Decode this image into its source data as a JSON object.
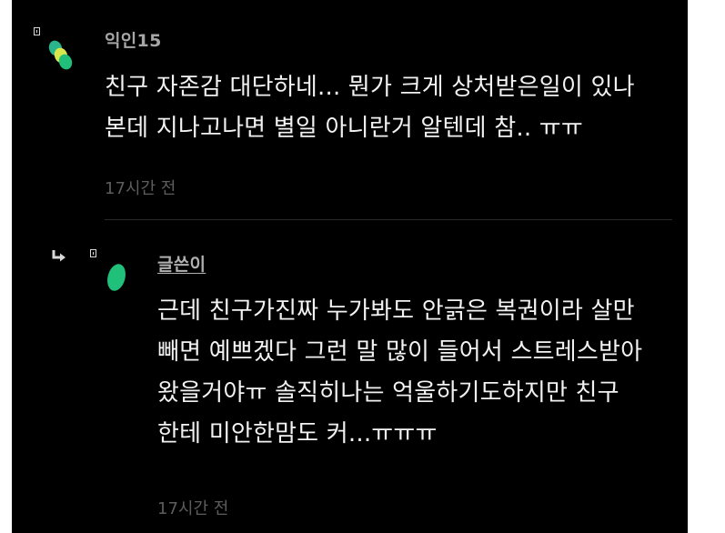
{
  "comments": [
    {
      "nickname": "익인15",
      "content": "친구 자존감 대단하네... 뭔가 크게 상처받은일이 있나\n본데 지나고나면 별일 아니란거 알텐데 참.. ㅠㅠ",
      "time": "17시간 전"
    }
  ],
  "replies": [
    {
      "nickname": "글쓴이",
      "content": "근데 친구가진짜 누가봐도 안긁은 복권이라 살만\n빼면 예쁘겠다 그런 말 많이 들어서 스트레스받아\n왔을거야ㅠ 솔직히나는 억울하기도하지만 친구\n한테 미안한맘도 커...ㅠㅠㅠ",
      "time": "17시간 전"
    }
  ],
  "icons": {
    "reply_arrow": "reply-arrow-icon",
    "flag": "small-box-icon",
    "avatar_main": "green-yellow-circles-avatar",
    "avatar_author": "green-circle-avatar"
  },
  "colors": {
    "background": "#000000",
    "nickname": "#a6a6a6",
    "content": "#f2f2f2",
    "time": "#5d5d5d",
    "avatar_green": "#20c07a",
    "avatar_yellow": "#d8e84a",
    "avatar_teal": "#2ab58a"
  }
}
